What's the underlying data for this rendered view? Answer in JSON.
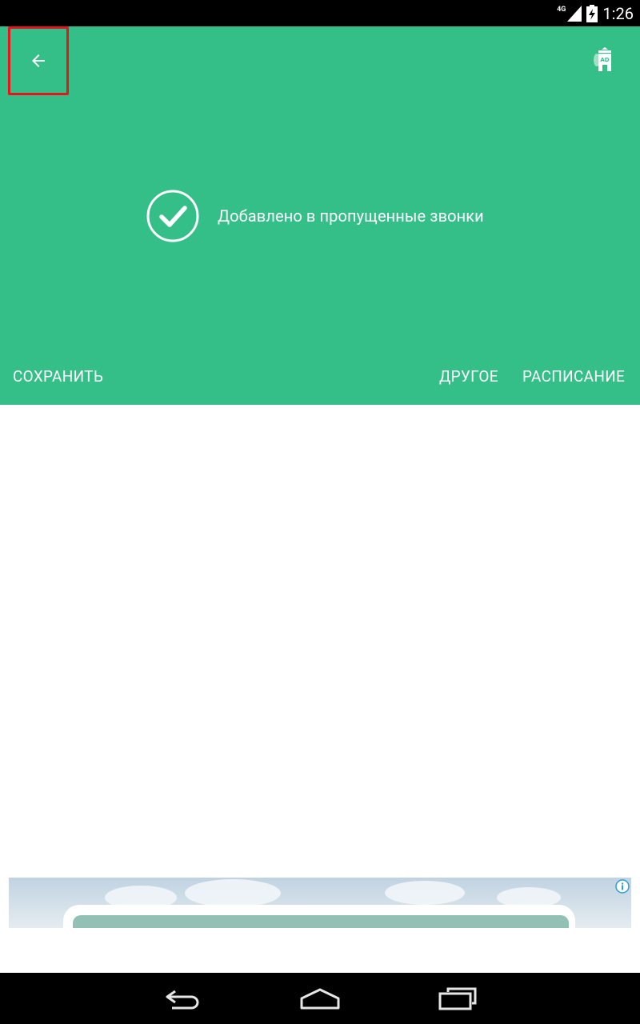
{
  "status_bar": {
    "network": "4G",
    "time": "1:26"
  },
  "header": {
    "background_color": "#33bf87",
    "back_icon": "arrow-back-icon",
    "adblock_icon": "ad-shield-icon",
    "confirmation": {
      "icon": "check-circle-icon",
      "text": "Добавлено в пропущенные звонки"
    },
    "actions": {
      "save": "СОХРАНИТЬ",
      "other": "ДРУГОЕ",
      "schedule": "РАСПИСАНИЕ"
    }
  },
  "ad": {
    "info_icon": "info-icon"
  },
  "nav_bar": {
    "back_icon": "nav-back-icon",
    "home_icon": "nav-home-icon",
    "recents_icon": "nav-recents-icon"
  }
}
